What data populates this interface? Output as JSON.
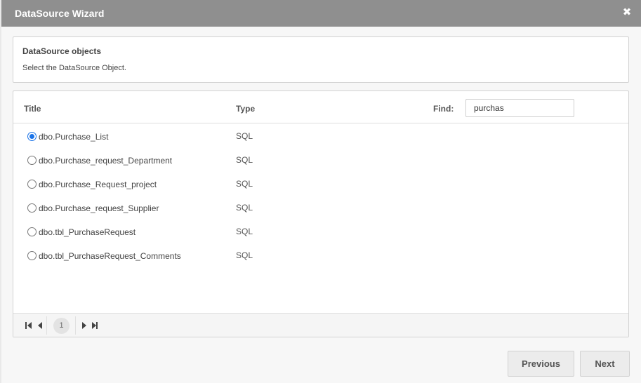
{
  "window": {
    "title": "DataSource Wizard",
    "close_icon": "✖"
  },
  "info": {
    "title": "DataSource objects",
    "description": "Select the DataSource Object."
  },
  "grid": {
    "columns": {
      "title": "Title",
      "type": "Type"
    },
    "find": {
      "label": "Find:",
      "value": "purchas"
    },
    "rows": [
      {
        "name": "dbo.Purchase_List",
        "type": "SQL",
        "selected": true
      },
      {
        "name": "dbo.Purchase_request_Department",
        "type": "SQL",
        "selected": false
      },
      {
        "name": "dbo.Purchase_Request_project",
        "type": "SQL",
        "selected": false
      },
      {
        "name": "dbo.Purchase_request_Supplier",
        "type": "SQL",
        "selected": false
      },
      {
        "name": "dbo.tbl_PurchaseRequest",
        "type": "SQL",
        "selected": false
      },
      {
        "name": "dbo.tbl_PurchaseRequest_Comments",
        "type": "SQL",
        "selected": false
      }
    ],
    "pager": {
      "current_page": "1"
    }
  },
  "buttons": {
    "previous": "Previous",
    "next": "Next"
  }
}
